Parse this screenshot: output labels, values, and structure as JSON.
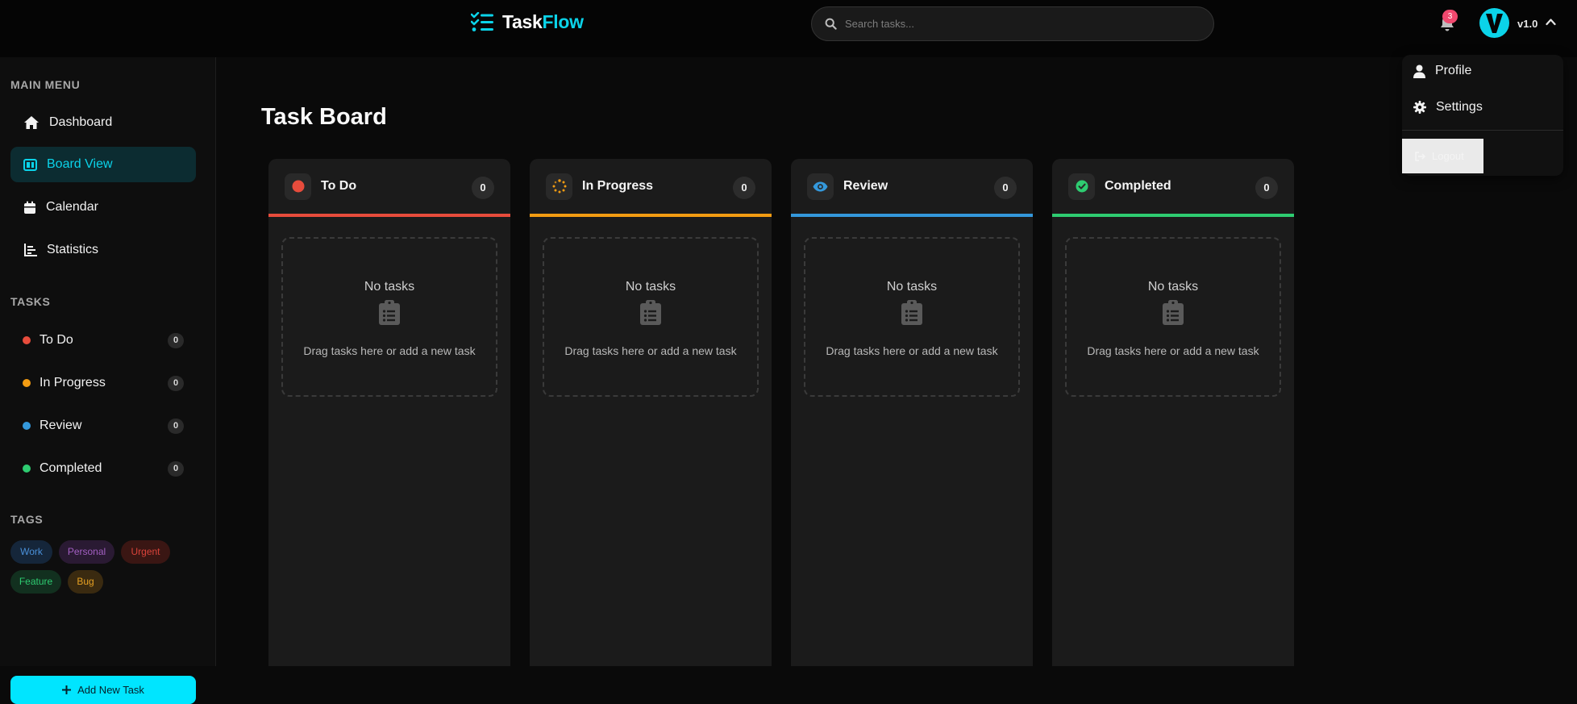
{
  "app": {
    "name_a": "Task",
    "name_b": "Flow",
    "version": "v1.0",
    "notification_count": "3",
    "accent": "#0bd3e9"
  },
  "search": {
    "placeholder": "Search tasks..."
  },
  "sidebar": {
    "main_menu_title": "MAIN MENU",
    "main_menu": [
      {
        "label": "Dashboard",
        "icon": "home-icon"
      },
      {
        "label": "Board View",
        "icon": "board-icon",
        "active": true
      },
      {
        "label": "Calendar",
        "icon": "calendar-icon"
      },
      {
        "label": "Statistics",
        "icon": "chart-icon"
      }
    ],
    "tasks_title": "TASKS",
    "tasks": [
      {
        "label": "To Do",
        "count": "0",
        "color": "#e74c3c"
      },
      {
        "label": "In Progress",
        "count": "0",
        "color": "#f39c12"
      },
      {
        "label": "Review",
        "count": "0",
        "color": "#3498db"
      },
      {
        "label": "Completed",
        "count": "0",
        "color": "#2ecc71"
      }
    ],
    "tags_title": "TAGS",
    "tags": [
      {
        "label": "Work",
        "color": "#4a90d9"
      },
      {
        "label": "Personal",
        "color": "#a35fc2"
      },
      {
        "label": "Urgent",
        "color": "#d9433a"
      },
      {
        "label": "Feature",
        "color": "#2ecc71"
      },
      {
        "label": "Bug",
        "color": "#e5a023"
      }
    ],
    "add_button": "Add New Task"
  },
  "main": {
    "title": "Task Board",
    "columns": [
      {
        "title": "To Do",
        "count": "0",
        "color": "#e74c3c",
        "icon": "circle-icon"
      },
      {
        "title": "In Progress",
        "count": "0",
        "color": "#f39c12",
        "icon": "spinner-icon"
      },
      {
        "title": "Review",
        "count": "0",
        "color": "#3498db",
        "icon": "eye-icon"
      },
      {
        "title": "Completed",
        "count": "0",
        "color": "#2ecc71",
        "icon": "check-circle-icon"
      }
    ],
    "empty_title": "No tasks",
    "empty_subtitle": "Drag tasks here or add a new task"
  },
  "dropdown": {
    "profile": "Profile",
    "settings": "Settings",
    "logout": "Logout"
  }
}
